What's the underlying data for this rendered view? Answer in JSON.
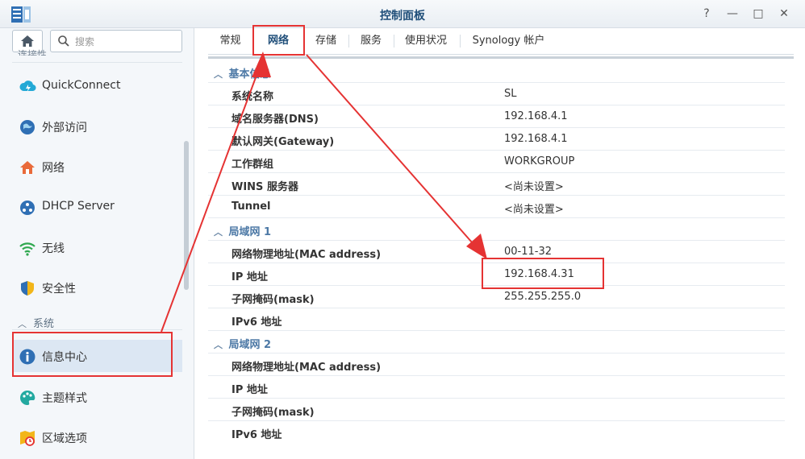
{
  "window": {
    "title": "控制面板",
    "help_label": "?",
    "minimize_label": "—",
    "maximize_label": "□",
    "close_label": "✕"
  },
  "sidebar": {
    "search_placeholder": "搜索",
    "cut_section": "连接性",
    "items": [
      {
        "label": "QuickConnect",
        "icon": "quickconnect-icon"
      },
      {
        "label": "外部访问",
        "icon": "globe-icon"
      },
      {
        "label": "网络",
        "icon": "home-network-icon"
      },
      {
        "label": "DHCP Server",
        "icon": "dhcp-icon"
      },
      {
        "label": "无线",
        "icon": "wifi-icon"
      },
      {
        "label": "安全性",
        "icon": "shield-icon"
      }
    ],
    "section_system": "系统",
    "system_items": [
      {
        "label": "信息中心",
        "icon": "info-icon"
      },
      {
        "label": "主题样式",
        "icon": "palette-icon"
      },
      {
        "label": "区域选项",
        "icon": "region-icon"
      }
    ]
  },
  "tabs": [
    "常规",
    "网络",
    "存储",
    "服务",
    "使用状况",
    "Synology 帐户"
  ],
  "active_tab": "网络",
  "groups": [
    {
      "title": "基本信息",
      "rows": [
        {
          "k": "系统名称",
          "v": "SL"
        },
        {
          "k": "域名服务器(DNS)",
          "v": "192.168.4.1"
        },
        {
          "k": "默认网关(Gateway)",
          "v": "192.168.4.1"
        },
        {
          "k": "工作群组",
          "v": "WORKGROUP"
        },
        {
          "k": "WINS 服务器",
          "v": "<尚未设置>"
        },
        {
          "k": "Tunnel",
          "v": "<尚未设置>"
        }
      ]
    },
    {
      "title": "局域网 1",
      "rows": [
        {
          "k": "网络物理地址(MAC address)",
          "v": "00-11-32"
        },
        {
          "k": "IP 地址",
          "v": "192.168.4.31"
        },
        {
          "k": "子网掩码(mask)",
          "v": "255.255.255.0"
        },
        {
          "k": "IPv6 地址",
          "v": ""
        }
      ]
    },
    {
      "title": "局域网 2",
      "rows": [
        {
          "k": "网络物理地址(MAC address)",
          "v": ""
        },
        {
          "k": "IP 地址",
          "v": ""
        },
        {
          "k": "子网掩码(mask)",
          "v": ""
        },
        {
          "k": "IPv6 地址",
          "v": ""
        }
      ]
    }
  ],
  "colors": {
    "accent": "#1f6fb2",
    "annotation": "#e53333",
    "group_title": "#4d79a6"
  }
}
